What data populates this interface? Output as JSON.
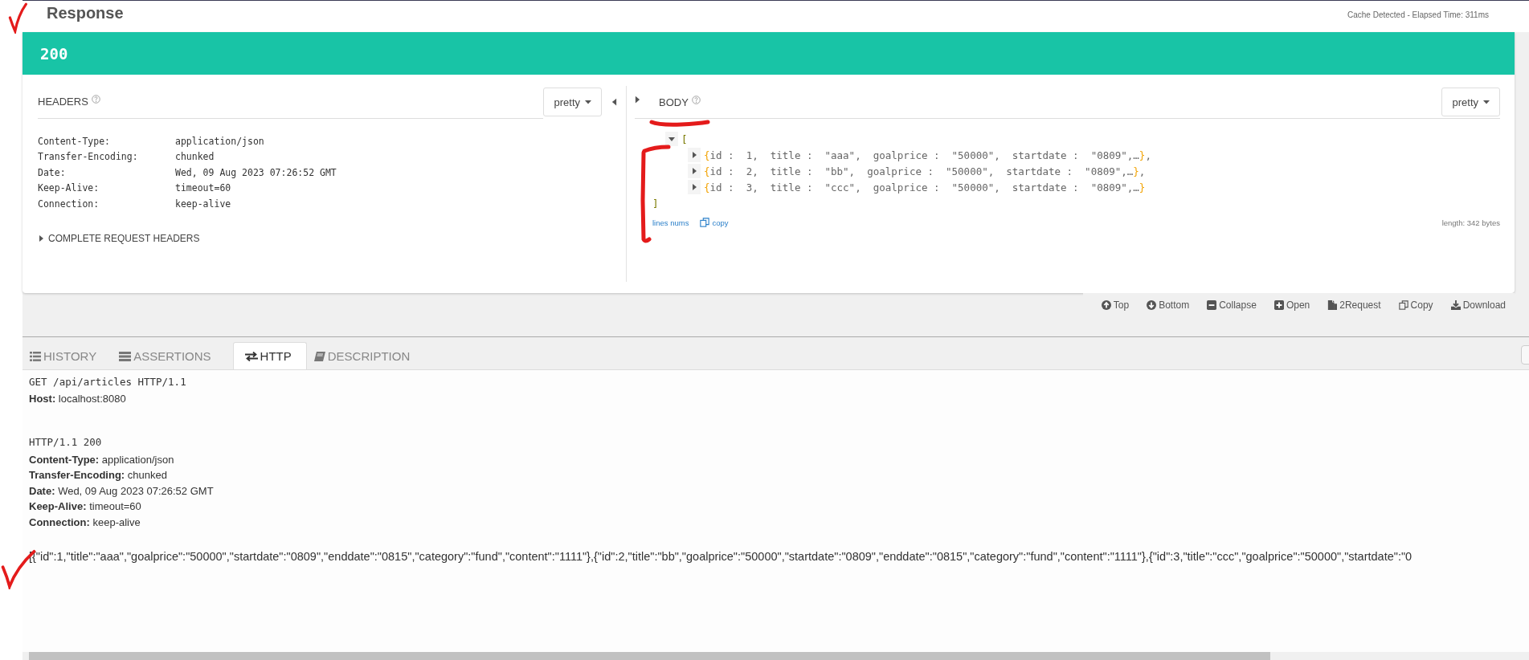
{
  "response": {
    "title": "Response",
    "cache_info": "Cache Detected - Elapsed Time: 311ms",
    "status": "200"
  },
  "headers_panel": {
    "title": "HEADERS",
    "format": "pretty",
    "rows": [
      {
        "name": "Content-Type:",
        "value": "application/json"
      },
      {
        "name": "Transfer-Encoding:",
        "value": "chunked"
      },
      {
        "name": "Date:",
        "value": "Wed, 09 Aug 2023 07:26:52 GMT"
      },
      {
        "name": "Keep-Alive:",
        "value": "timeout=60"
      },
      {
        "name": "Connection:",
        "value": "keep-alive"
      }
    ],
    "complete_headers": {
      "label": "COMPLETE REQUEST HEADERS",
      "expanded": false
    }
  },
  "body_panel": {
    "title": "BODY",
    "format": "pretty",
    "open": "[",
    "close": "]",
    "expanded": true,
    "items": [
      {
        "open": "{",
        "text": "id :  1,  title :  \"aaa\",  goalprice :  \"50000\",  startdate :  \"0809\",…",
        "close": "}",
        "trail": ",",
        "expanded": false
      },
      {
        "open": "{",
        "text": "id :  2,  title :  \"bb\",  goalprice :  \"50000\",  startdate :  \"0809\",…",
        "close": "}",
        "trail": ",",
        "expanded": false
      },
      {
        "open": "{",
        "text": "id :  3,  title :  \"ccc\",  goalprice :  \"50000\",  startdate :  \"0809\",…",
        "close": "}",
        "expanded": false
      }
    ],
    "line_numbers_link": "lines nums",
    "copy_link": "copy",
    "length": "length: 342 bytes"
  },
  "toolbar": [
    {
      "kind": "top",
      "label": "Top"
    },
    {
      "kind": "bottom",
      "label": "Bottom"
    },
    {
      "kind": "collapse",
      "label": "Collapse"
    },
    {
      "kind": "open",
      "label": "Open"
    },
    {
      "kind": "request",
      "label": "2Request"
    },
    {
      "kind": "copy",
      "label": "Copy"
    },
    {
      "kind": "download",
      "label": "Download"
    }
  ],
  "tabs": [
    {
      "kind": "history",
      "label": "HISTORY",
      "selected": false
    },
    {
      "kind": "assertions",
      "label": "ASSERTIONS",
      "selected": false
    },
    {
      "kind": "http",
      "label": "HTTP",
      "selected": true
    },
    {
      "kind": "description",
      "label": "DESCRIPTION",
      "selected": false
    }
  ],
  "http": {
    "request_line": "GET /api/articles HTTP/1.1",
    "request_headers": [
      {
        "name": "Host:",
        "value": "localhost:8080"
      }
    ],
    "status_line": "HTTP/1.1 200",
    "response_headers": [
      {
        "name": "Content-Type:",
        "value": "application/json"
      },
      {
        "name": "Transfer-Encoding:",
        "value": "chunked"
      },
      {
        "name": "Date:",
        "value": "Wed, 09 Aug 2023 07:26:52 GMT"
      },
      {
        "name": "Keep-Alive:",
        "value": "timeout=60"
      },
      {
        "name": "Connection:",
        "value": "keep-alive"
      }
    ],
    "body": "[{\"id\":1,\"title\":\"aaa\",\"goalprice\":\"50000\",\"startdate\":\"0809\",\"enddate\":\"0815\",\"category\":\"fund\",\"content\":\"1111\"},{\"id\":2,\"title\":\"bb\",\"goalprice\":\"50000\",\"startdate\":\"0809\",\"enddate\":\"0815\",\"category\":\"fund\",\"content\":\"1111\"},{\"id\":3,\"title\":\"ccc\",\"goalprice\":\"50000\",\"startdate\":\"0"
  }
}
